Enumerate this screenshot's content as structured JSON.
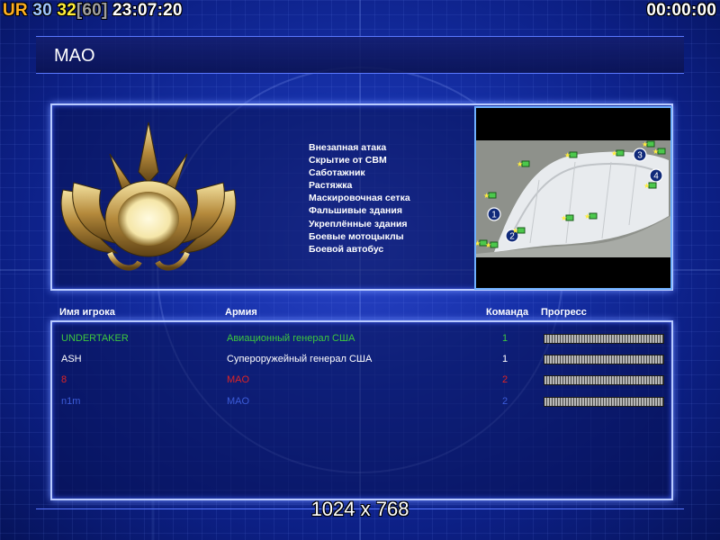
{
  "hud": {
    "left": [
      {
        "text": "UR ",
        "color": "orange"
      },
      {
        "text": "30 ",
        "color": "lblue"
      },
      {
        "text": "32",
        "color": "yellow"
      },
      {
        "text": "[60] ",
        "color": "grey"
      },
      {
        "text": "23:07:20",
        "color": "white"
      }
    ],
    "timer": "00:00:00"
  },
  "title": "MAO",
  "features": [
    "Внезапная атака",
    "Скрытие от СВМ",
    "Саботажник",
    "Растяжка",
    "Маскировочная сетка",
    "Фальшивые здания",
    "Укреплённые здания",
    "Боевые мотоцыклы",
    "Боевой автобус"
  ],
  "minimap": {
    "start_markers": [
      "1",
      "2",
      "3",
      "4"
    ]
  },
  "columns": {
    "name": "Имя игрока",
    "army": "Армия",
    "team": "Команда",
    "progress": "Прогресс"
  },
  "players": [
    {
      "name": "UNDERTAKER",
      "army": "Авиационный генерал США",
      "team": "1",
      "color": "#3ec83e",
      "progress": 1.0
    },
    {
      "name": "ASH",
      "army": "Супероружейный генерал США",
      "team": "1",
      "color": "#ffffff",
      "progress": 1.0
    },
    {
      "name": "8",
      "army": "MAO",
      "team": "2",
      "color": "#e02424",
      "progress": 1.0
    },
    {
      "name": "n1m",
      "army": "MAO",
      "team": "2",
      "color": "#3c5cd8",
      "progress": 1.0
    }
  ],
  "resolution": "1024 x 768",
  "colors": {
    "orange": "#ffb020",
    "lblue": "#9ec6ff",
    "yellow": "#ffee3a",
    "grey": "#a0a0a0",
    "white": "#ffffff"
  }
}
